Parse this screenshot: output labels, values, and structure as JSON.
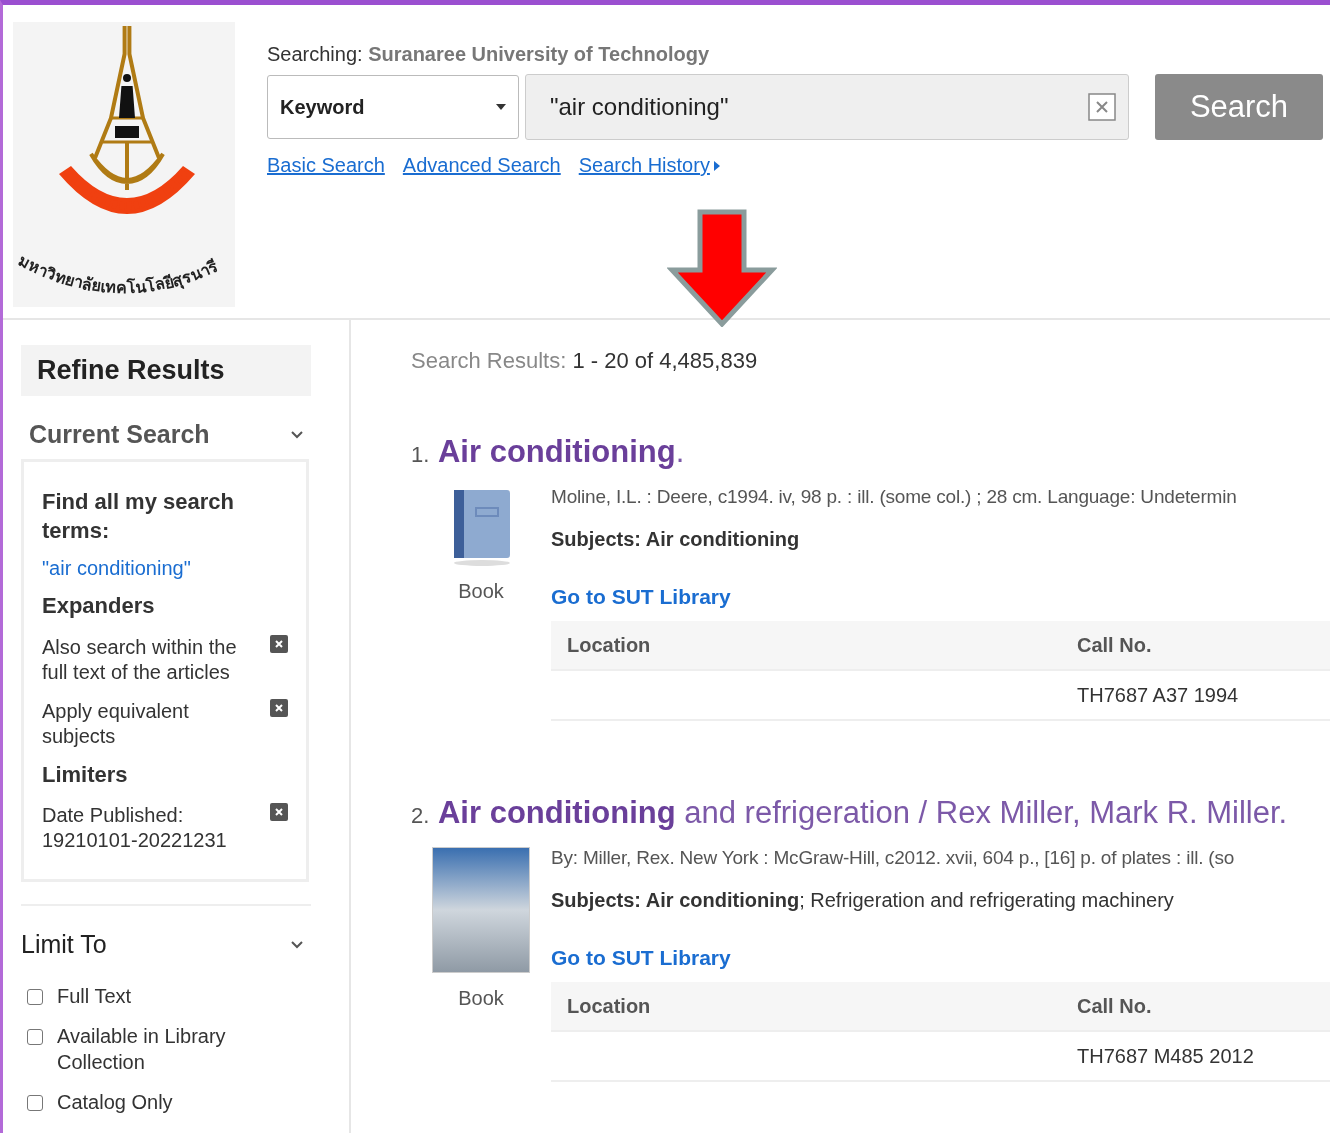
{
  "logo": {
    "text": "มหาวิทยาลัยเทคโนโลยีสุรนารี"
  },
  "search": {
    "scope_label": "Searching:",
    "scope": "Suranaree University of Technology",
    "field_type": "Keyword",
    "query": "\"air conditioning\"",
    "button": "Search",
    "links": [
      {
        "label": "Basic Search",
        "caret": false
      },
      {
        "label": "Advanced Search",
        "caret": false
      },
      {
        "label": "Search History",
        "caret": true
      }
    ]
  },
  "sidebar": {
    "title": "Refine Results",
    "current_search": {
      "heading": "Current Search",
      "expanded": true,
      "terms_heading": "Find all my search terms:",
      "term": "\"air conditioning\"",
      "groups": [
        {
          "heading": "Expanders",
          "items": [
            "Also search within the full text of the articles",
            "Apply equivalent subjects"
          ]
        },
        {
          "heading": "Limiters",
          "items": [
            "Date Published: 19210101-20221231"
          ]
        }
      ]
    },
    "limit_to": {
      "heading": "Limit To",
      "expanded": true,
      "options": [
        {
          "label": "Full Text",
          "checked": false
        },
        {
          "label": "Available in Library Collection",
          "checked": false
        },
        {
          "label": "Catalog Only",
          "checked": false
        }
      ]
    }
  },
  "results": {
    "summary_label": "Search Results:",
    "summary": "1 - 20 of 4,485,839",
    "items": [
      {
        "number": "1.",
        "title": "**Air conditioning**.",
        "kind": "icon",
        "type": "Book",
        "details": "Moline, I.L. : Deere, c1994. iv, 98 p. : ill. (some col.) ; 28 cm. Language: Undetermin",
        "subjects": "**Subjects: Air conditioning**",
        "link": "Go to SUT Library",
        "columns": [
          "Location",
          "Call No."
        ],
        "rows": [
          [
            "",
            "TH7687 A37 1994"
          ]
        ]
      },
      {
        "number": "2.",
        "title": "**Air conditioning** and refrigeration / Rex Miller, Mark R. Miller.",
        "kind": "image",
        "type": "Book",
        "details": "By: Miller, Rex. New York : McGraw-Hill, c2012. xvii, 604 p., [16] p. of plates : ill. (so",
        "subjects": "**Subjects: Air conditioning**; Refrigeration and refrigerating machinery",
        "link": "Go to SUT Library",
        "columns": [
          "Location",
          "Call No."
        ],
        "rows": [
          [
            "",
            "TH7687 M485 2012"
          ]
        ]
      }
    ]
  }
}
